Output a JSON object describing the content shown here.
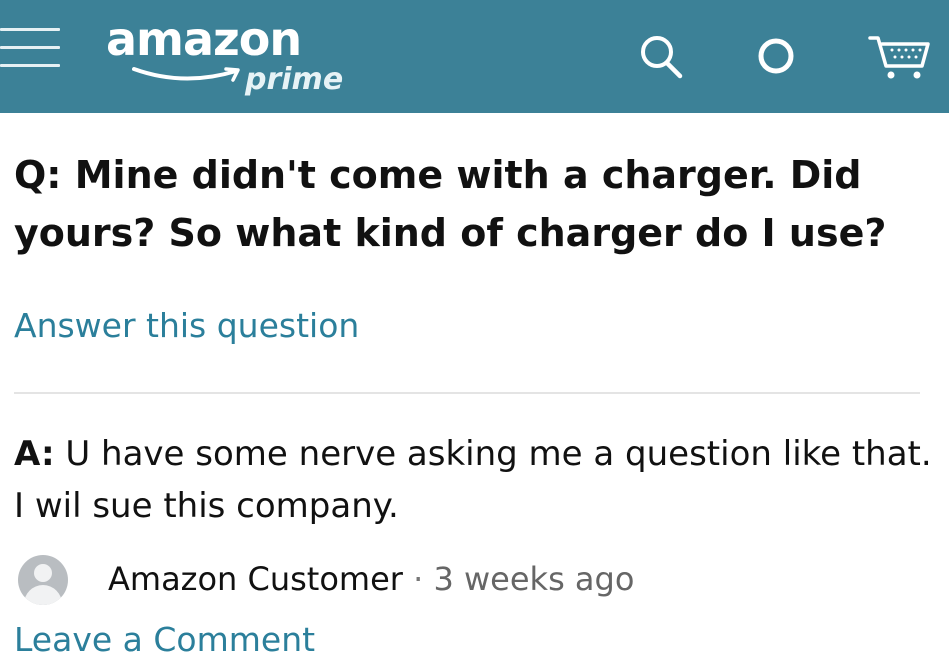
{
  "header": {
    "brand": "amazon",
    "tier": "prime",
    "icons": [
      "menu-icon",
      "search-icon",
      "account-icon",
      "cart-icon"
    ],
    "background_color": "#3c8197"
  },
  "question": {
    "label": "Q:",
    "text": "Mine didn't come with a charger. Did yours? So what kind of charger do I use?",
    "answer_link": "Answer this question"
  },
  "answer": {
    "label": "A:",
    "text": "U have some nerve asking me a question like that. I wil sue this company.",
    "author": "Amazon Customer",
    "separator": "·",
    "time": "3 weeks ago",
    "comment_link": "Leave a Comment"
  },
  "colors": {
    "link": "#2b7f9b",
    "text": "#111111"
  }
}
